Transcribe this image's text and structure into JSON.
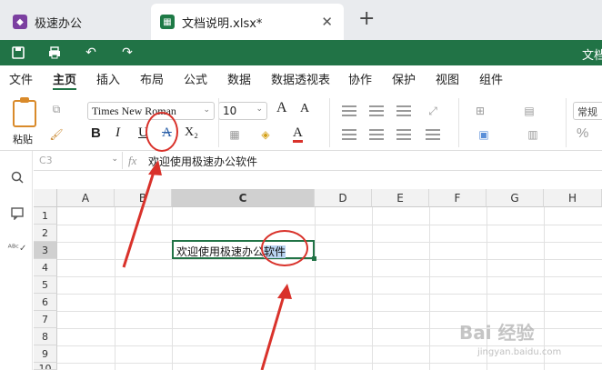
{
  "tabs": [
    {
      "title": "极速办公",
      "icon": "app-logo-icon"
    },
    {
      "title": "文档说明.xlsx*",
      "icon": "spreadsheet-icon",
      "close": "✕"
    }
  ],
  "tab_add": "+",
  "quickbar": {
    "title_fragment": "文档",
    "icons": [
      "save-icon",
      "print-icon",
      "undo-icon",
      "redo-icon"
    ],
    "accent": "#217346"
  },
  "menu": [
    "文件",
    "主页",
    "插入",
    "布局",
    "公式",
    "数据",
    "数据透视表",
    "协作",
    "保护",
    "视图",
    "组件"
  ],
  "ribbon": {
    "paste_label": "粘贴",
    "font_name": "Times New Roman",
    "font_size": "10",
    "bold": "B",
    "italic": "I",
    "underline": "U",
    "strikethrough": "A",
    "subscript": "X₂",
    "font_color": "A",
    "grow": "A",
    "shrink": "A",
    "number_format": "常规",
    "percent": "%"
  },
  "sidebar": [
    "search-icon",
    "comment-icon",
    "spellcheck-icon"
  ],
  "formula_bar": {
    "cell_ref": "C3",
    "fx": "fx",
    "content": "欢迎使用极速办公软件"
  },
  "grid": {
    "columns": [
      "A",
      "B",
      "C",
      "D",
      "E",
      "F",
      "G",
      "H"
    ],
    "selected_column": "C",
    "rows": [
      "1",
      "2",
      "3",
      "4",
      "5",
      "6",
      "7",
      "8",
      "9",
      "10"
    ],
    "selected_row": "3",
    "active_cell_text_plain": "欢迎使用极速办公",
    "active_cell_text_selected": "软件"
  },
  "watermark": {
    "text": "Bai 经验",
    "sub": "jingyan.baidu.com"
  }
}
